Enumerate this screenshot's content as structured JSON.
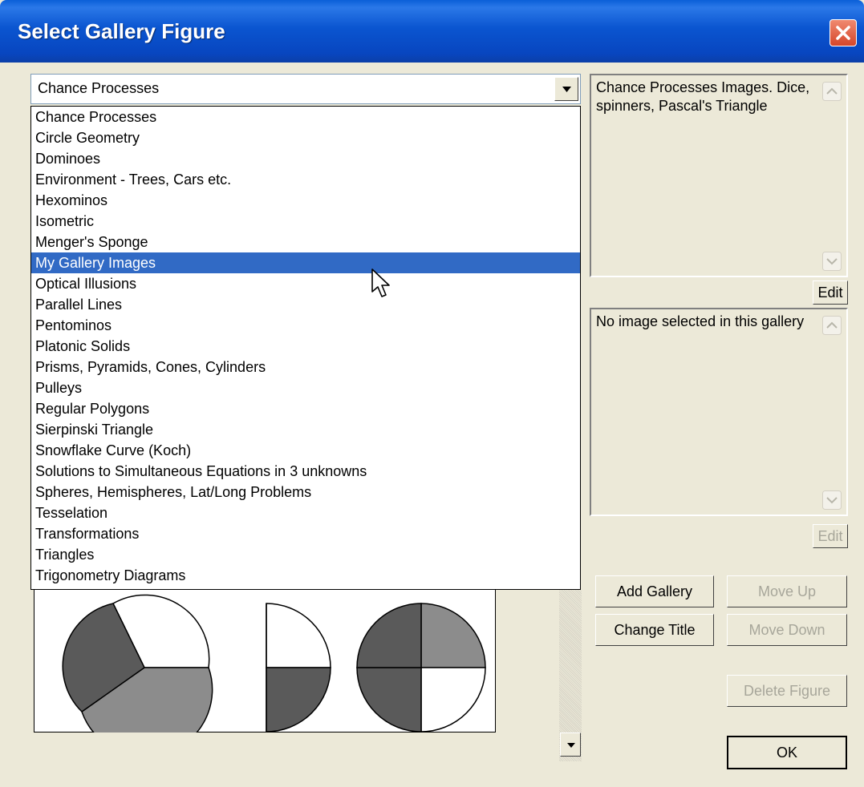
{
  "window": {
    "title": "Select Gallery Figure"
  },
  "combo": {
    "selected": "Chance Processes"
  },
  "list": {
    "items": [
      "Chance Processes",
      "Circle Geometry",
      "Dominoes",
      "Environment - Trees, Cars etc.",
      "Hexominos",
      "Isometric",
      "Menger's Sponge",
      "My Gallery Images",
      "Optical Illusions",
      "Parallel Lines",
      "Pentominos",
      "Platonic Solids",
      "Prisms, Pyramids, Cones, Cylinders",
      "Pulleys",
      "Regular Polygons",
      "Sierpinski Triangle",
      "Snowflake Curve (Koch)",
      "Solutions to Simultaneous Equations in 3 unknowns",
      "Spheres, Hemispheres, Lat/Long Problems",
      "Tesselation",
      "Transformations",
      "Triangles",
      "Trigonometry Diagrams"
    ],
    "highlighted": "My Gallery Images"
  },
  "gallery_description": {
    "text": "Chance Processes Images. Dice, spinners, Pascal's Triangle",
    "edit_label": "Edit"
  },
  "image_description": {
    "text": "No image selected in this gallery",
    "edit_label": "Edit"
  },
  "buttons": {
    "add_gallery": "Add Gallery",
    "move_up": "Move Up",
    "change_title": "Change Title",
    "move_down": "Move Down",
    "delete_figure": "Delete Figure",
    "ok": "OK"
  },
  "icons": {
    "close": "close-icon",
    "dropdown": "chevron-down-icon",
    "cursor": "mouse-pointer-icon"
  },
  "colors": {
    "titlebar": "#0a55d0",
    "selection": "#316ac5",
    "dialog_bg": "#ece9d8",
    "disabled_text": "#a7a69a"
  }
}
